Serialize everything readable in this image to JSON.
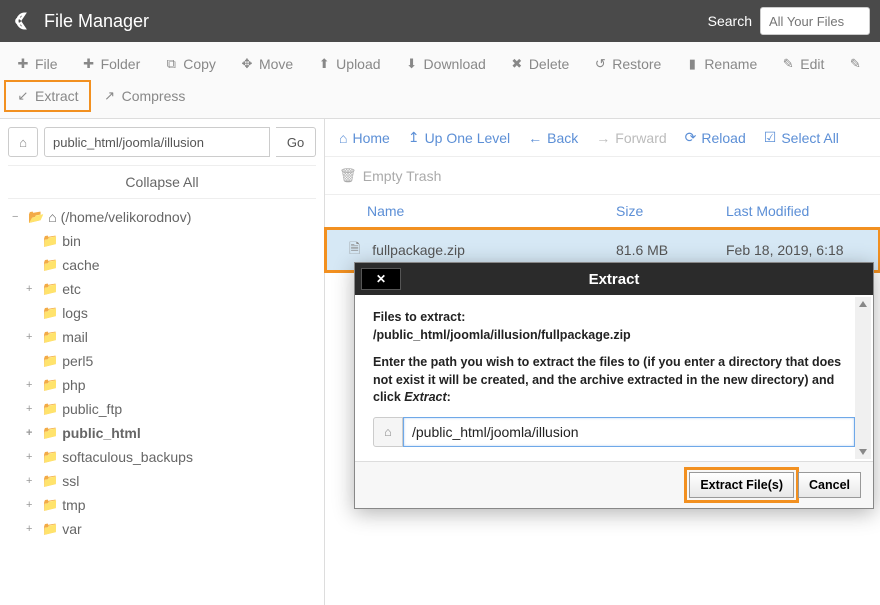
{
  "header": {
    "title": "File Manager",
    "search_label": "Search",
    "search_placeholder": "All Your Files"
  },
  "toolbar": {
    "file": "File",
    "folder": "Folder",
    "copy": "Copy",
    "move": "Move",
    "upload": "Upload",
    "download": "Download",
    "delete": "Delete",
    "restore": "Restore",
    "rename": "Rename",
    "edit": "Edit",
    "extract": "Extract",
    "compress": "Compress"
  },
  "sidebar": {
    "path_value": "public_html/joomla/illusion",
    "go": "Go",
    "collapse_all": "Collapse All",
    "root_label": "(/home/velikorodnov)",
    "items": [
      {
        "label": "bin",
        "expandable": false
      },
      {
        "label": "cache",
        "expandable": false
      },
      {
        "label": "etc",
        "expandable": true
      },
      {
        "label": "logs",
        "expandable": false
      },
      {
        "label": "mail",
        "expandable": true
      },
      {
        "label": "perl5",
        "expandable": false
      },
      {
        "label": "php",
        "expandable": true
      },
      {
        "label": "public_ftp",
        "expandable": true
      },
      {
        "label": "public_html",
        "expandable": true,
        "bold": true
      },
      {
        "label": "softaculous_backups",
        "expandable": true
      },
      {
        "label": "ssl",
        "expandable": true
      },
      {
        "label": "tmp",
        "expandable": true
      },
      {
        "label": "var",
        "expandable": true
      }
    ]
  },
  "nav": {
    "home": "Home",
    "up": "Up One Level",
    "back": "Back",
    "forward": "Forward",
    "reload": "Reload",
    "select_all": "Select All",
    "empty_trash": "Empty Trash"
  },
  "columns": {
    "name": "Name",
    "size": "Size",
    "modified": "Last Modified"
  },
  "files": [
    {
      "name": "fullpackage.zip",
      "size": "81.6 MB",
      "modified": "Feb 18, 2019, 6:18 "
    }
  ],
  "modal": {
    "title": "Extract",
    "files_to_extract_label": "Files to extract:",
    "files_to_extract_path": "/public_html/joomla/illusion/fullpackage.zip",
    "instruction_pre": "Enter the path you wish to extract the files to (if you enter a directory that does not exist it will be created, and the archive extracted in the new directory) and click ",
    "instruction_em": "Extract",
    "path_value": "/public_html/joomla/illusion",
    "extract_btn": "Extract File(s)",
    "cancel_btn": "Cancel"
  }
}
